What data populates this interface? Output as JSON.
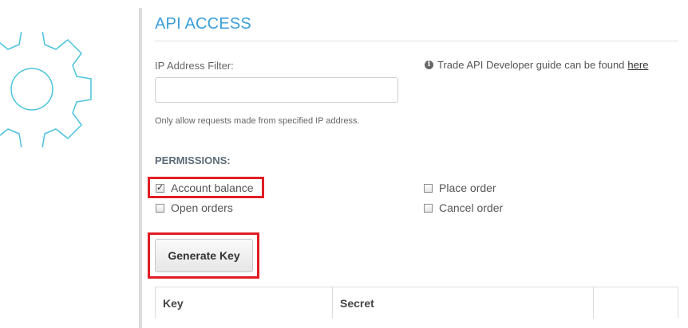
{
  "page": {
    "title": "API ACCESS"
  },
  "ip_filter": {
    "label": "IP Address Filter:",
    "value": "",
    "placeholder": "",
    "help": "Only allow requests made from specified IP address."
  },
  "guide": {
    "text": "Trade API Developer guide can be found",
    "link_label": "here",
    "icon": "info-icon"
  },
  "permissions": {
    "title": "PERMISSIONS:",
    "items": [
      {
        "label": "Account balance",
        "checked": true
      },
      {
        "label": "Open orders",
        "checked": false
      },
      {
        "label": "Place order",
        "checked": false
      },
      {
        "label": "Cancel order",
        "checked": false
      }
    ]
  },
  "actions": {
    "generate_label": "Generate Key"
  },
  "keys_table": {
    "columns": [
      "Key",
      "Secret",
      ""
    ]
  },
  "colors": {
    "accent": "#3a9fd8",
    "highlight": "#e01d24",
    "gear": "#4cc3dc"
  }
}
